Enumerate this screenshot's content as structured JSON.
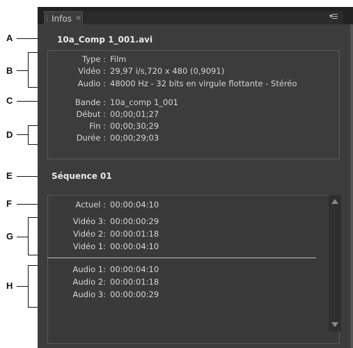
{
  "panel": {
    "tab_label": "Infos",
    "tab_close": "×",
    "menu_icon": "panel-menu-icon"
  },
  "clip": {
    "title": "10a_Comp 1_001.avi",
    "type_label": "Type :",
    "type_value": "Film",
    "video_label": "Vidéo :",
    "video_value": "29,97 i/s,720 x 480 (0,9091)",
    "audio_label": "Audio :",
    "audio_value": "48000 Hz - 32 bits en virgule flottante - Stéréo",
    "tape_label": "Bande :",
    "tape_value": "10a_comp 1_001",
    "start_label": "Début :",
    "start_value": "00;00;01;27",
    "end_label": "Fin :",
    "end_value": "00;00;30;29",
    "duration_label": "Durée :",
    "duration_value": "00;00;29;03"
  },
  "sequence": {
    "title": "Séquence 01",
    "current_label": "Actuel :",
    "current_value": "00:00:04:10",
    "video_tracks": [
      {
        "label": "Vidéo 3:",
        "value": "00:00:00:29"
      },
      {
        "label": "Vidéo 2:",
        "value": "00:00:01:18"
      },
      {
        "label": "Vidéo 1:",
        "value": "00:00:04:10"
      }
    ],
    "audio_tracks": [
      {
        "label": "Audio 1:",
        "value": "00:00:04:10"
      },
      {
        "label": "Audio 2:",
        "value": "00:00:01:18"
      },
      {
        "label": "Audio 3:",
        "value": "00:00:00:29"
      }
    ]
  },
  "callouts": [
    "A",
    "B",
    "C",
    "D",
    "E",
    "F",
    "G",
    "H"
  ],
  "colors": {
    "panel_bg": "#3c3c3c",
    "text": "#d6d6d6",
    "callout_line": "#111111"
  }
}
